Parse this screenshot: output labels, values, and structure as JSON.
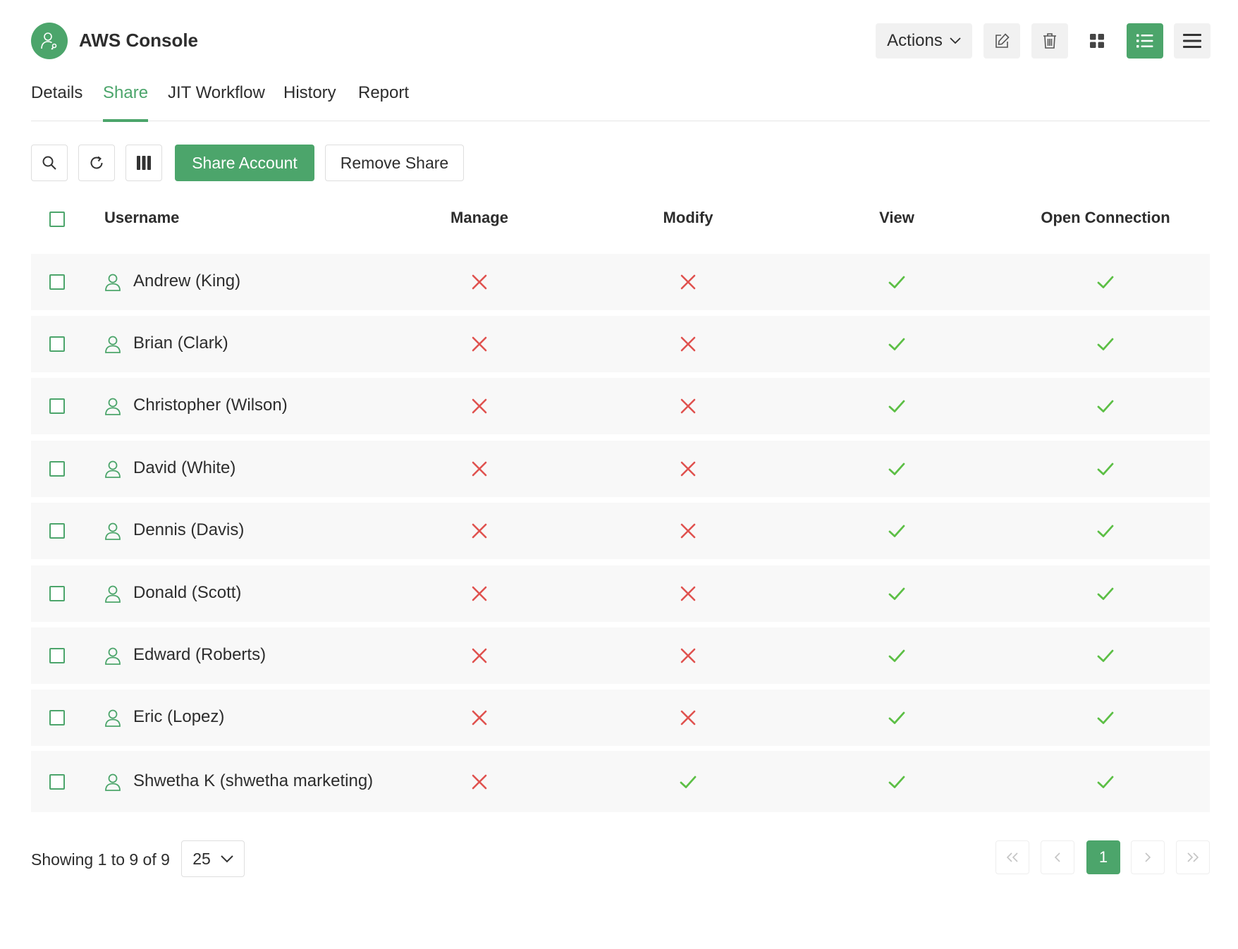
{
  "header": {
    "title": "AWS Console",
    "actions_label": "Actions",
    "icons": [
      "user-key-icon",
      "chevron-down-icon",
      "edit-icon",
      "trash-icon",
      "grid-view-icon",
      "list-view-icon",
      "hamburger-menu-icon"
    ]
  },
  "tabs": [
    {
      "label": "Details",
      "active": false
    },
    {
      "label": "Share",
      "active": true
    },
    {
      "label": "JIT Workflow",
      "active": false
    },
    {
      "label": "History",
      "active": false
    },
    {
      "label": "Report",
      "active": false
    }
  ],
  "toolbar": {
    "share_label": "Share Account",
    "remove_label": "Remove Share",
    "icons": [
      "search-icon",
      "refresh-icon",
      "columns-icon"
    ]
  },
  "table": {
    "columns": [
      "Username",
      "Manage",
      "Modify",
      "View",
      "Open Connection"
    ],
    "rows": [
      {
        "username": "Andrew (King)",
        "manage": false,
        "modify": false,
        "view": true,
        "open_connection": true
      },
      {
        "username": "Brian (Clark)",
        "manage": false,
        "modify": false,
        "view": true,
        "open_connection": true
      },
      {
        "username": "Christopher (Wilson)",
        "manage": false,
        "modify": false,
        "view": true,
        "open_connection": true
      },
      {
        "username": "David (White)",
        "manage": false,
        "modify": false,
        "view": true,
        "open_connection": true
      },
      {
        "username": "Dennis (Davis)",
        "manage": false,
        "modify": false,
        "view": true,
        "open_connection": true
      },
      {
        "username": "Donald (Scott)",
        "manage": false,
        "modify": false,
        "view": true,
        "open_connection": true
      },
      {
        "username": "Edward (Roberts)",
        "manage": false,
        "modify": false,
        "view": true,
        "open_connection": true
      },
      {
        "username": "Eric (Lopez)",
        "manage": false,
        "modify": false,
        "view": true,
        "open_connection": true
      },
      {
        "username": "Shwetha K (shwetha marketing)",
        "manage": false,
        "modify": true,
        "view": true,
        "open_connection": true
      }
    ]
  },
  "footer": {
    "showing": "Showing 1 to 9 of 9",
    "page_size": "25",
    "current_page": "1"
  },
  "colors": {
    "accent": "#4ca56b",
    "deny": "#e0524f",
    "allow": "#5cbf45",
    "row_bg": "#f8f8f8"
  }
}
